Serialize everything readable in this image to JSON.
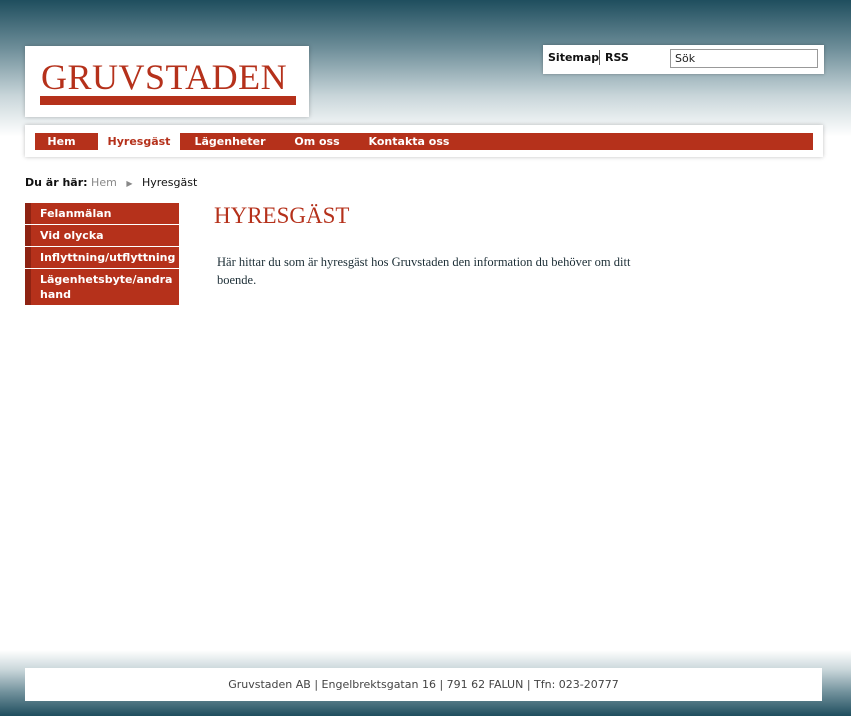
{
  "logo": {
    "text": "GRUVSTADEN"
  },
  "utility": {
    "sitemap_label": "Sitemap",
    "rss_label": "RSS",
    "search_value": "Sök"
  },
  "nav": {
    "items": [
      {
        "label": "Hem"
      },
      {
        "label": "Hyresgäst"
      },
      {
        "label": "Lägenheter"
      },
      {
        "label": "Om oss"
      },
      {
        "label": "Kontakta oss"
      }
    ],
    "active": "Hyresgäst"
  },
  "breadcrumb": {
    "label": "Du är här:",
    "items": [
      {
        "label": "Hem"
      },
      {
        "label": "Hyresgäst"
      }
    ]
  },
  "sidebar": {
    "items": [
      {
        "label": "Felanmälan"
      },
      {
        "label": "Vid olycka"
      },
      {
        "label": "Inflyttning/utflyttning"
      },
      {
        "label": "Lägenhetsbyte/andra hand"
      }
    ]
  },
  "main": {
    "title": "HYRESGÄST",
    "intro": "Här hittar du som är hyresgäst hos Gruvstaden den information du behöver om ditt boende."
  },
  "footer": {
    "text": "Gruvstaden AB | Engelbrektsgatan 16 | 791 62 FALUN | Tfn: 023-20777"
  },
  "colors": {
    "accent": "#b5311b",
    "header_dark": "#1f4e5e"
  }
}
